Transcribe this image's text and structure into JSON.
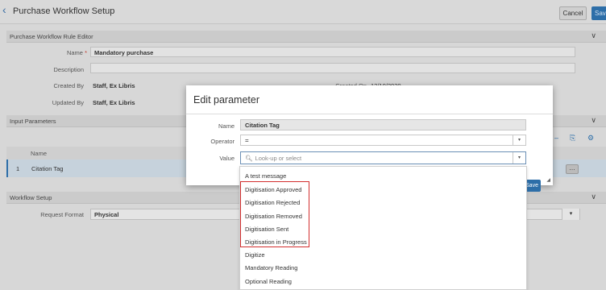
{
  "header": {
    "title": "Purchase Workflow Setup",
    "cancel_label": "Cancel",
    "save_label": "Save"
  },
  "rule_editor": {
    "section_title": "Purchase Workflow Rule Editor",
    "name_label": "Name",
    "name_value": "Mandatory purchase",
    "description_label": "Description",
    "created_by_label": "Created By",
    "created_by_value": "Staff, Ex Libris",
    "updated_by_label": "Updated By",
    "updated_by_value": "Staff, Ex Libris",
    "created_on_label": "Created On",
    "created_on_value": "12/10/2020"
  },
  "input_parameters": {
    "section_title": "Input Parameters",
    "column_name": "Name",
    "rows": [
      {
        "num": "1",
        "name": "Citation Tag"
      }
    ]
  },
  "workflow_setup": {
    "section_title": "Workflow Setup",
    "request_format_label": "Request Format",
    "request_format_value": "Physical"
  },
  "modal": {
    "title": "Edit parameter",
    "name_label": "Name",
    "name_value": "Citation Tag",
    "operator_label": "Operator",
    "operator_value": "=",
    "value_label": "Value",
    "value_placeholder": "Look-up or select",
    "save_label": "Save"
  },
  "dropdown": {
    "options": [
      "A test message",
      "Digitisation Approved",
      "Digitisation Rejected",
      "Digitisation Removed",
      "Digitisation Sent",
      "Digitisation in Progress",
      "Digitize",
      "Mandatory Reading",
      "Optional Reading"
    ]
  },
  "colors": {
    "accent": "#2d6ea8",
    "highlight": "#d32f2f"
  },
  "icons": [
    "back-arrow-icon",
    "chevron-down-icon",
    "export-icon",
    "gear-icon",
    "search-icon",
    "more-icon",
    "resize-icon"
  ]
}
